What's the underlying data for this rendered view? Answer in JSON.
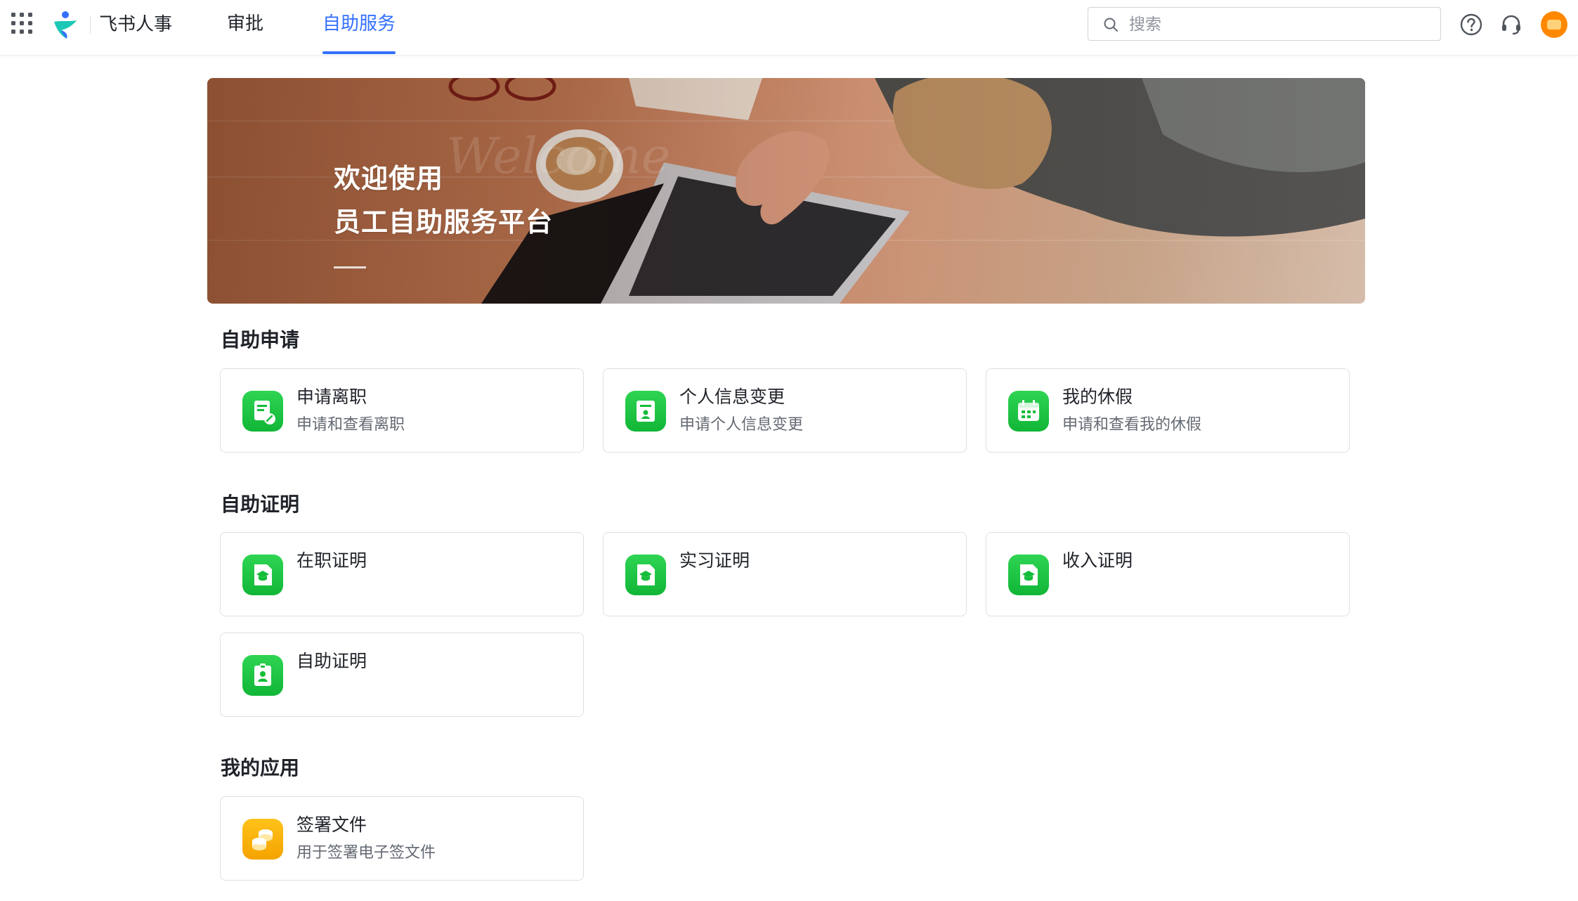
{
  "header": {
    "app_title": "飞书人事",
    "tabs": [
      {
        "label": "审批",
        "active": false
      },
      {
        "label": "自助服务",
        "active": true
      }
    ],
    "search_placeholder": "搜索",
    "icons": [
      "apps-grid-icon",
      "feishu-people-logo",
      "help-icon",
      "headset-icon",
      "avatar"
    ],
    "accent_color": "#3370ff"
  },
  "banner": {
    "line1": "欢迎使用",
    "line2": "员工自助服务平台",
    "ghost_text": "Welcome"
  },
  "sections": [
    {
      "title": "自助申请",
      "cards": [
        {
          "title": "申请离职",
          "desc": "申请和查看离职",
          "icon": "resign-doc-icon"
        },
        {
          "title": "个人信息变更",
          "desc": "申请个人信息变更",
          "icon": "profile-doc-icon"
        },
        {
          "title": "我的休假",
          "desc": "申请和查看我的休假",
          "icon": "calendar-icon"
        }
      ]
    },
    {
      "title": "自助证明",
      "cards": [
        {
          "title": "在职证明",
          "icon": "certificate-icon"
        },
        {
          "title": "实习证明",
          "icon": "certificate-icon"
        },
        {
          "title": "收入证明",
          "icon": "certificate-icon"
        },
        {
          "title": "自助证明",
          "icon": "id-badge-icon"
        }
      ]
    },
    {
      "title": "我的应用",
      "cards": [
        {
          "title": "签署文件",
          "desc": "用于签署电子签文件",
          "icon": "coins-icon"
        }
      ]
    }
  ],
  "colors": {
    "icon_green": "#14bd3a",
    "icon_yellow": "#f8b100"
  }
}
